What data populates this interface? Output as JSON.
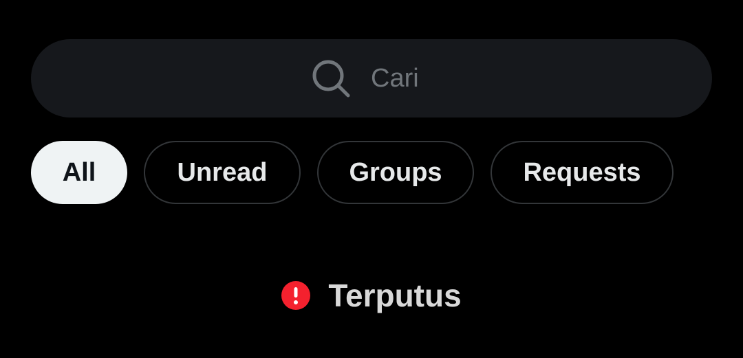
{
  "search": {
    "placeholder": "Cari",
    "icon": "search-icon"
  },
  "filters": [
    {
      "label": "All",
      "active": true
    },
    {
      "label": "Unread",
      "active": false
    },
    {
      "label": "Groups",
      "active": false
    },
    {
      "label": "Requests",
      "active": false
    }
  ],
  "status": {
    "text": "Terputus",
    "icon": "alert-circle-icon",
    "icon_color": "#f4212e"
  },
  "colors": {
    "background": "#000000",
    "search_bg": "#16181c",
    "chip_active_bg": "#eff3f4",
    "chip_border": "#333639",
    "text_primary": "#e7e9ea",
    "text_muted": "#71767b"
  }
}
